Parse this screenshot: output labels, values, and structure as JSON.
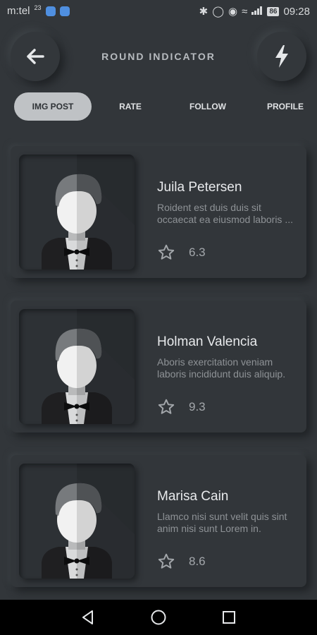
{
  "status_bar": {
    "carrier": "m:tel",
    "carrier_sup": "23",
    "battery": "86",
    "time": "09:28"
  },
  "header": {
    "title": "ROUND INDICATOR",
    "back_icon": "arrow-left-icon",
    "action_icon": "lightning-icon"
  },
  "tabs": [
    {
      "label": "IMG POST",
      "active": true
    },
    {
      "label": "RATE",
      "active": false
    },
    {
      "label": "FOLLOW",
      "active": false
    },
    {
      "label": "PROFILE",
      "active": false
    }
  ],
  "cards": [
    {
      "name": "Juila Petersen",
      "description": "Roident est duis duis sit occaecat ea eiusmod laboris ...",
      "rating": "6.3"
    },
    {
      "name": "Holman Valencia",
      "description": "Aboris exercitation veniam laboris incididunt duis aliquip.",
      "rating": "9.3"
    },
    {
      "name": "Marisa Cain",
      "description": "Llamco nisi sunt velit quis sint anim nisi sunt Lorem in.",
      "rating": "8.6"
    }
  ],
  "colors": {
    "background": "#32363a",
    "active_tab": "#bfc2c5",
    "name_text": "#e8eaec",
    "desc_text": "#8e9296"
  }
}
